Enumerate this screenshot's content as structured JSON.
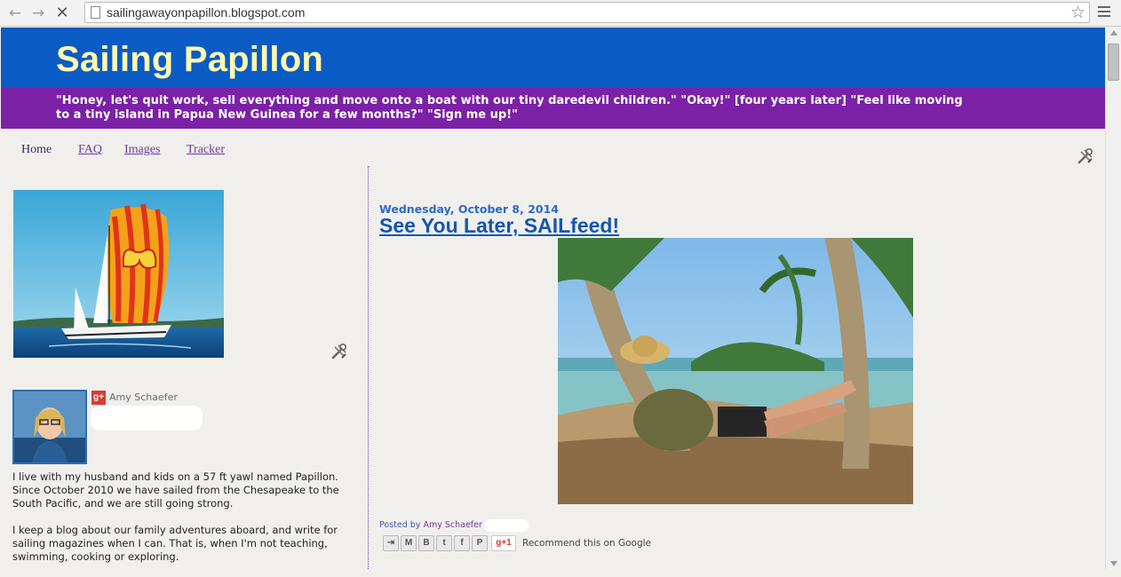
{
  "browser": {
    "url": "sailingawayonpapillon.blogspot.com",
    "back_icon": "back-arrow-icon",
    "forward_icon": "forward-arrow-icon",
    "stop_icon": "stop-x-icon"
  },
  "header": {
    "title": "Sailing Papillon",
    "description": "\"Honey, let's quit work, sell everything and move onto a boat with our tiny daredevil children.\" \"Okay!\" [four years later] \"Feel like moving to a tiny island in Papua New Guinea for a few months?\" \"Sign me up!\"",
    "colors": {
      "header_bg": "#0a5bc4",
      "title": "#fff8b0",
      "desc_bg": "#7b21a6"
    }
  },
  "tabs": [
    {
      "label": "Home",
      "active": true
    },
    {
      "label": "FAQ"
    },
    {
      "label": "Images"
    },
    {
      "label": "Tracker"
    }
  ],
  "sidebar": {
    "profile": {
      "gplus_label": "g+",
      "name": "Amy Schaefer"
    },
    "about": [
      "I live with my husband and kids on a 57 ft yawl named Papillon. Since October 2010 we have sailed from the Chesapeake to the South Pacific, and we are still going strong.",
      "I keep a blog about our family adventures aboard, and write for sailing magazines when I can.  That is, when I'm not teaching, swimming, cooking or exploring."
    ]
  },
  "post": {
    "date": "Wednesday, October 8, 2014",
    "title": "See You Later, SAILfeed!",
    "posted_by_label": "Posted by",
    "author": "Amy Schaefer",
    "share": {
      "buttons": [
        "email-this",
        "gmail",
        "blogger",
        "twitter",
        "facebook",
        "pinterest"
      ],
      "gplus_label": "g+1",
      "recommend": "Recommend this on Google"
    }
  }
}
